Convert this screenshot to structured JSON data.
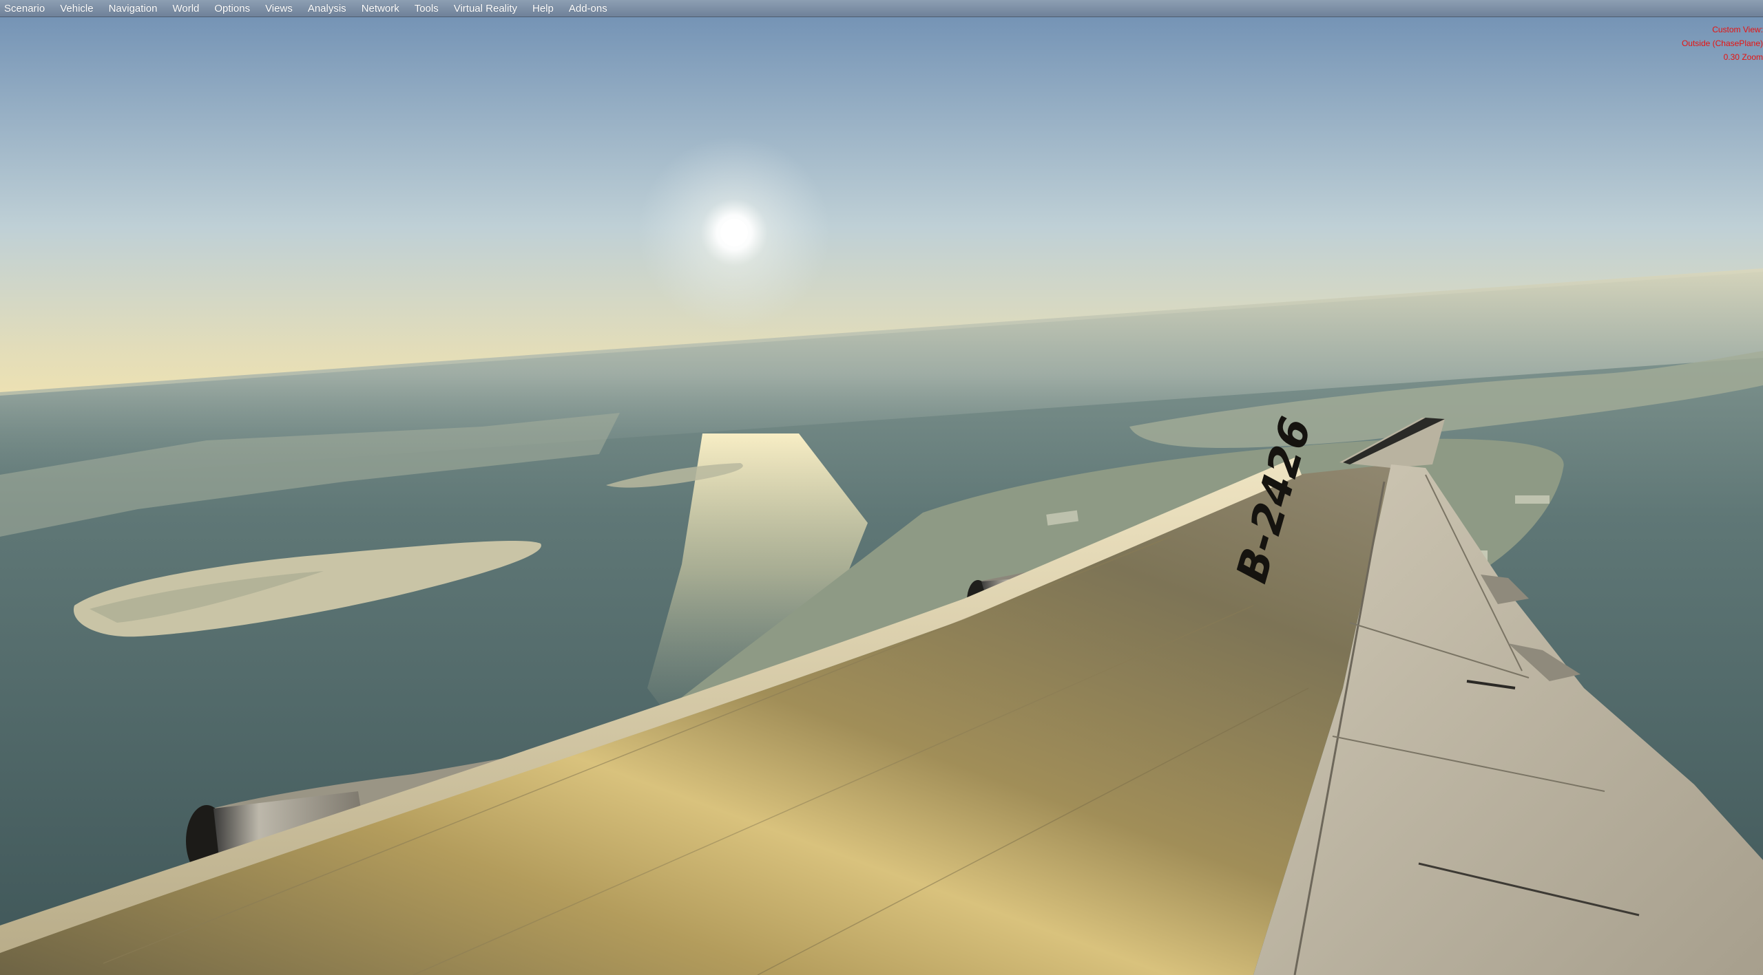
{
  "menu": {
    "items": [
      {
        "label": "Scenario"
      },
      {
        "label": "Vehicle"
      },
      {
        "label": "Navigation"
      },
      {
        "label": "World"
      },
      {
        "label": "Options"
      },
      {
        "label": "Views"
      },
      {
        "label": "Analysis"
      },
      {
        "label": "Network"
      },
      {
        "label": "Tools"
      },
      {
        "label": "Virtual Reality"
      },
      {
        "label": "Help"
      },
      {
        "label": "Add-ons"
      }
    ]
  },
  "view_info": {
    "line1": "Custom View:",
    "line2": "Outside (ChasePlane)",
    "line3": "0.30 Zoom",
    "color": "#e8120f"
  },
  "scene": {
    "aircraft_registration": "B-2426",
    "sky_top_color": "#6f8fb3",
    "horizon_color": "#e9dfb8",
    "water_color": "#4f676a"
  }
}
